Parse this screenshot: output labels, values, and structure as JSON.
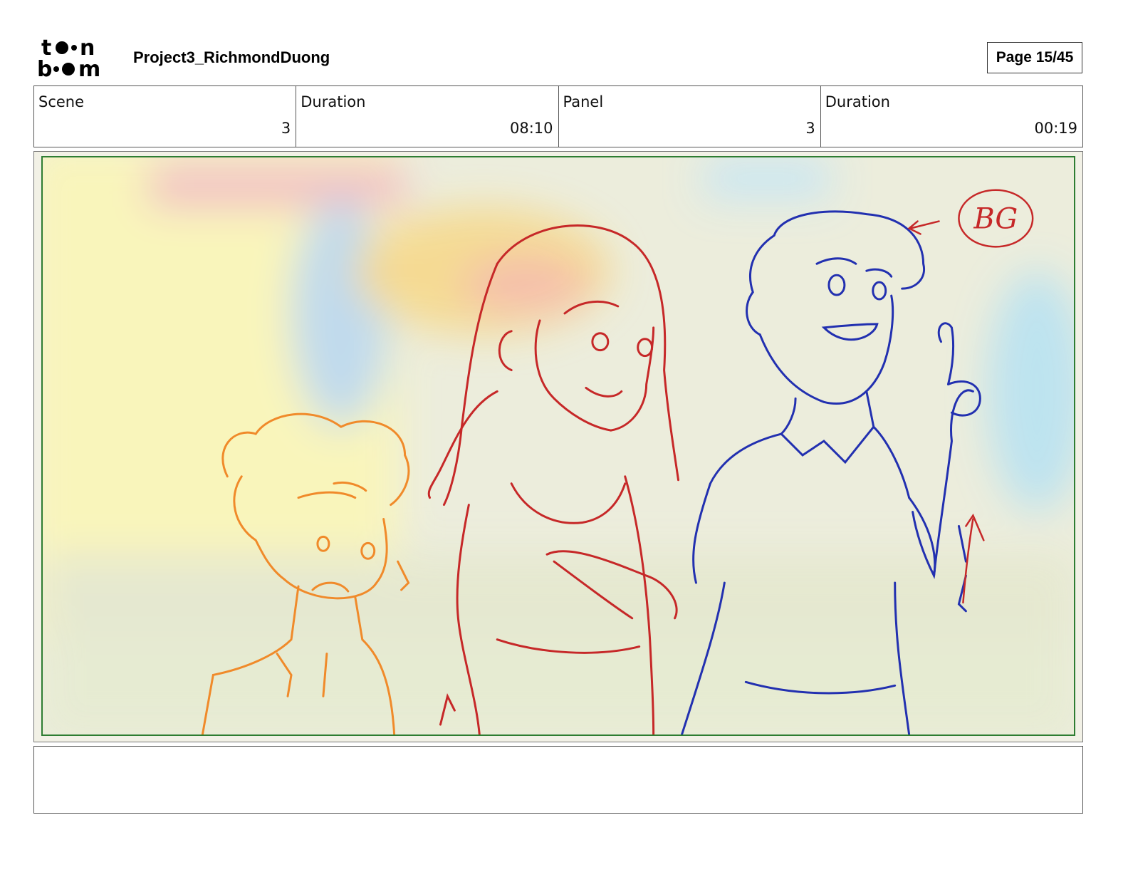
{
  "header": {
    "logo_text": "toonboom",
    "project_title": "Project3_RichmondDuong",
    "page_label": "Page 15/45"
  },
  "info": {
    "scene_label": "Scene",
    "scene_value": "3",
    "scene_duration_label": "Duration",
    "scene_duration_value": "08:10",
    "panel_label": "Panel",
    "panel_value": "3",
    "panel_duration_label": "Duration",
    "panel_duration_value": "00:19"
  },
  "panel": {
    "annotation_text": "BG",
    "colors": {
      "frame": "#2e7d32",
      "orange_sketch": "#f08a2a",
      "red_sketch": "#c62828",
      "blue_sketch": "#2230b0"
    }
  },
  "caption": {
    "text": ""
  }
}
